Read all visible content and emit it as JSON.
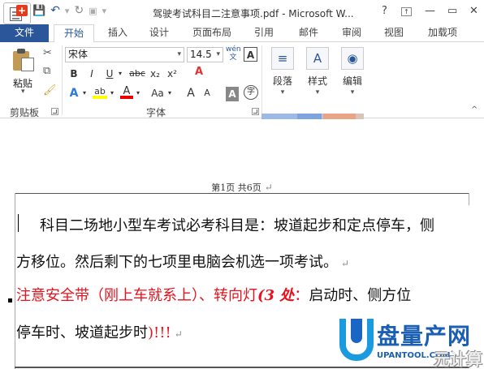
{
  "window": {
    "title": "驾驶考试科目二注意事项.pdf - Microsoft W...",
    "help": "?",
    "minimize": "—",
    "restore": "▭",
    "close": "✕"
  },
  "qat": {
    "save": "save-icon",
    "undo": "↶",
    "redo": "↻",
    "more": "▾"
  },
  "tabs": [
    {
      "label": "文件"
    },
    {
      "label": "开始"
    },
    {
      "label": "插入"
    },
    {
      "label": "设计"
    },
    {
      "label": "页面布局"
    },
    {
      "label": "引用"
    },
    {
      "label": "邮件"
    },
    {
      "label": "审阅"
    },
    {
      "label": "视图"
    },
    {
      "label": "加载项"
    }
  ],
  "ribbon": {
    "clipboard": {
      "paste": "粘贴",
      "group": "剪贴板"
    },
    "font": {
      "name": "宋体",
      "size": "14.5",
      "wen": "wén",
      "a_box": "A",
      "bold": "B",
      "italic": "I",
      "underline": "U",
      "strike": "abc",
      "sub": "x₂",
      "sup": "x²",
      "clear": "A",
      "text_effects": "A",
      "highlight": "ab",
      "font_color": "A",
      "change_case": "Aa",
      "grow": "A",
      "shrink": "A",
      "shade": "A",
      "enclose": "字",
      "group": "字体"
    },
    "paragraph": {
      "label": "段落"
    },
    "styles": {
      "label": "样式"
    },
    "editing": {
      "label": "编辑"
    }
  },
  "document": {
    "header": "第1页 共6页",
    "line1": "科目二场地小型车考试必考科目是：坡道起步和定点停车，侧",
    "line2": "方移位。然后剩下的七项里电脑会机选一项考试。",
    "line3_red": "注意安全带（刚上车就系上）、转向灯",
    "line3_italic": "(3 处",
    "line3_red2": "：",
    "line3_black": "启动时、侧方位",
    "line4_black": "停车时、坡道起步时",
    "line4_red": ")!!!",
    "para_mark": "↵"
  },
  "watermark": {
    "title": "盘量产网",
    "subtitle": "UPANTOOL.COM",
    "corner": "元计算"
  },
  "colors": {
    "accent": "#2b579a",
    "red_text": "#e8111d"
  }
}
